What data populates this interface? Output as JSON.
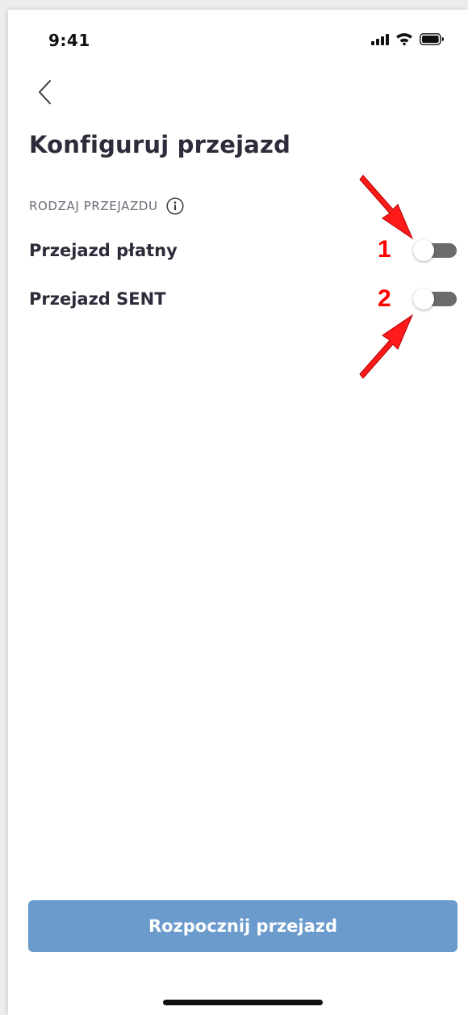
{
  "status_bar": {
    "time": "9:41",
    "icons": [
      "signal-icon",
      "wifi-icon",
      "battery-icon"
    ]
  },
  "header": {
    "back_icon": "chevron-left-icon",
    "title": "Konfiguruj przejazd"
  },
  "section": {
    "label": "RODZAJ PRZEJAZDU",
    "info_icon": "info-icon"
  },
  "options": [
    {
      "label": "Przejazd płatny",
      "enabled": false,
      "marker": "1"
    },
    {
      "label": "Przejazd SENT",
      "enabled": false,
      "marker": "2"
    }
  ],
  "primary_button": {
    "label": "Rozpocznij przejazd"
  },
  "colors": {
    "title": "#2c2c3a",
    "button": "#6b9bcd",
    "toggle_track_off": "#6b6b6b",
    "annotation": "#ff0000"
  }
}
